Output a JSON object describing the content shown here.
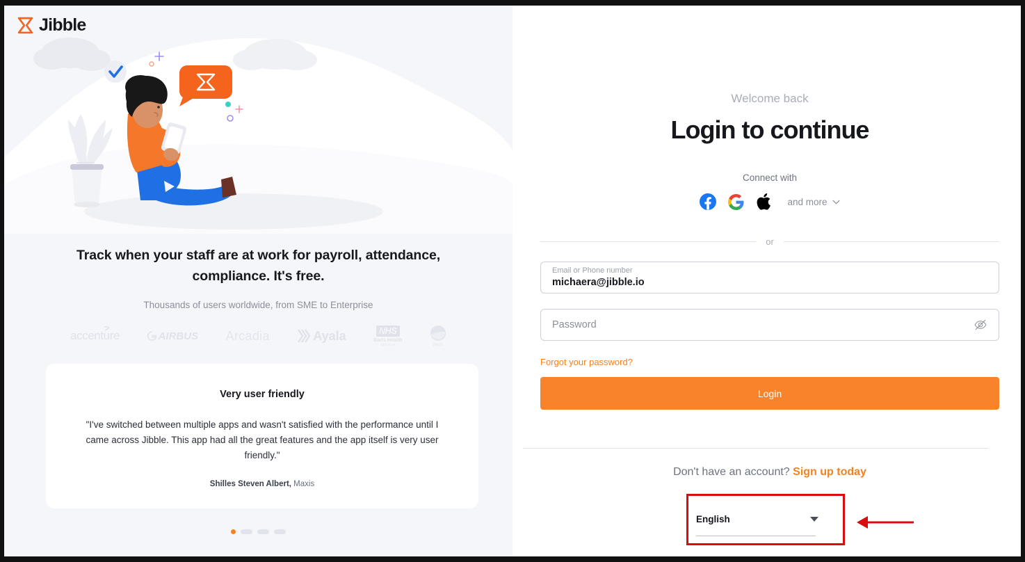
{
  "brand": {
    "name": "Jibble",
    "logo_icon": "hourglass-icon",
    "accent_color": "#f8832a",
    "orange_link_color": "#f58220"
  },
  "left_panel": {
    "headline": "Track when your staff are at work for payroll, attendance, compliance. It's free.",
    "subheadline": "Thousands of users worldwide, from SME to Enterprise",
    "client_logos": [
      {
        "name": "accenture",
        "label": "accenture"
      },
      {
        "name": "airbus",
        "label": "AIRBUS"
      },
      {
        "name": "arcadia",
        "label": "Arcadia"
      },
      {
        "name": "ayala",
        "label": "Ayala"
      },
      {
        "name": "nhs-barts-health",
        "label": "NHS",
        "sub": "Barts Health",
        "sub2": "NHS Trust"
      },
      {
        "name": "pepsi",
        "label": "pepsi"
      }
    ],
    "testimonial": {
      "title": "Very user friendly",
      "quote": "\"I've switched between multiple apps and wasn't satisfied with the performance until I came across Jibble. This app had all the great features and the app itself is very user friendly.\"",
      "author_name": "Shilles Steven Albert,",
      "author_company": "Maxis"
    },
    "carousel": {
      "active_index": 0,
      "total": 4
    },
    "illustration_alt": "person sitting with phone and hourglass speech bubble"
  },
  "right_panel": {
    "welcome": "Welcome back",
    "title": "Login to continue",
    "connect_with": "Connect with",
    "social_providers": [
      {
        "name": "facebook",
        "icon": "facebook-icon",
        "color": "#1877F2"
      },
      {
        "name": "google",
        "icon": "google-icon",
        "color": "#4285F4"
      },
      {
        "name": "apple",
        "icon": "apple-icon",
        "color": "#000000"
      }
    ],
    "and_more_label": "and more",
    "and_more_icon": "chevron-down-icon",
    "or_text": "or",
    "email_field": {
      "label": "Email or Phone number",
      "value": "michaera@jibble.io"
    },
    "password_field": {
      "placeholder": "Password",
      "value": "",
      "toggle_icon": "eye-off-icon"
    },
    "forgot_password": "Forgot your password?",
    "login_button": "Login",
    "signup_prompt": "Don't have an account?",
    "signup_link": "Sign up today",
    "language_selector": {
      "value": "English",
      "caret_icon": "caret-down-icon"
    }
  },
  "annotation": {
    "color": "#d80d0d",
    "highlight_target": "language-selector",
    "arrow_direction": "left"
  }
}
